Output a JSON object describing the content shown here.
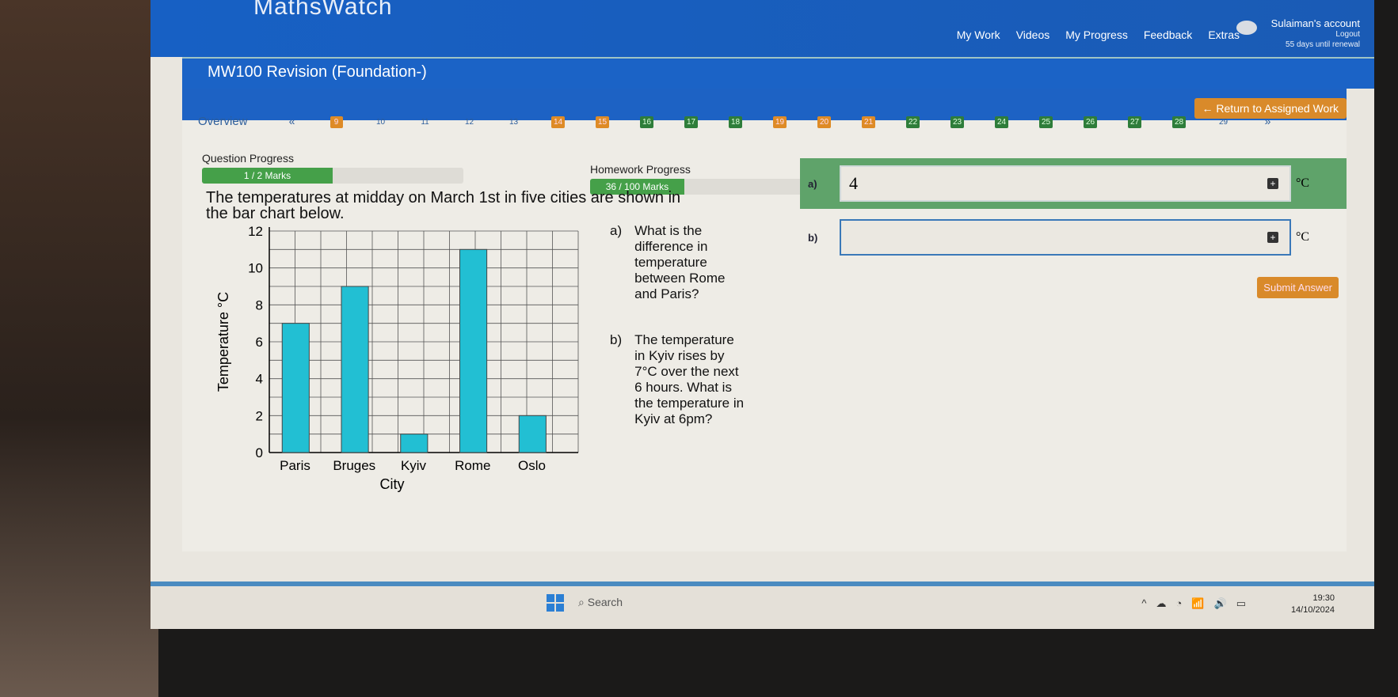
{
  "app": {
    "logo": "MathsWatch",
    "nav": [
      "My Work",
      "Videos",
      "My Progress",
      "Feedback",
      "Extras"
    ],
    "account": "Sulaiman's account",
    "logout": "Logout",
    "renewal": "55 days until renewal"
  },
  "course_title": "MW100 Revision (Foundation-)",
  "return_button": "← Return to Assigned Work",
  "overview": "Overview",
  "prev": "«",
  "next": "»",
  "questions": [
    {
      "n": "9",
      "s": "orange"
    },
    {
      "n": "10",
      "s": "none"
    },
    {
      "n": "11",
      "s": "none"
    },
    {
      "n": "12",
      "s": "none"
    },
    {
      "n": "13",
      "s": "none"
    },
    {
      "n": "14",
      "s": "orange"
    },
    {
      "n": "15",
      "s": "orange"
    },
    {
      "n": "16",
      "s": "green"
    },
    {
      "n": "17",
      "s": "green"
    },
    {
      "n": "18",
      "s": "green"
    },
    {
      "n": "19",
      "s": "orange"
    },
    {
      "n": "20",
      "s": "orange"
    },
    {
      "n": "21",
      "s": "orange"
    },
    {
      "n": "22",
      "s": "green"
    },
    {
      "n": "23",
      "s": "green"
    },
    {
      "n": "24",
      "s": "green"
    },
    {
      "n": "25",
      "s": "green"
    },
    {
      "n": "26",
      "s": "green"
    },
    {
      "n": "27",
      "s": "green"
    },
    {
      "n": "28",
      "s": "green"
    },
    {
      "n": "29",
      "s": "none"
    }
  ],
  "progress": {
    "question_label": "Question Progress",
    "question_value": "1 / 2 Marks",
    "question_fraction": 0.5,
    "homework_label": "Homework Progress",
    "homework_value": "36 / 100 Marks",
    "homework_fraction": 0.36
  },
  "question_text": "The temperatures at midday on March 1st in five cities are shown in the bar chart below.",
  "parts": [
    {
      "label": "a)",
      "text": "What is the difference in temperature between Rome and Paris?"
    },
    {
      "label": "b)",
      "text": "The temperature in Kyiv rises by 7°C over the next 6 hours. What is the temperature in Kyiv at 6pm?"
    }
  ],
  "answers": [
    {
      "label": "a)",
      "value": "4",
      "unit": "°C",
      "status": "correct"
    },
    {
      "label": "b)",
      "value": "",
      "unit": "°C",
      "status": "active"
    }
  ],
  "submit": "Submit Answer",
  "chart_data": {
    "type": "bar",
    "categories": [
      "Paris",
      "Bruges",
      "Kyiv",
      "Rome",
      "Oslo"
    ],
    "values": [
      7,
      9,
      1,
      11,
      2
    ],
    "xlabel": "City",
    "ylabel": "Temperature °C",
    "ylim": [
      0,
      12
    ],
    "yticks": [
      0,
      2,
      4,
      6,
      8,
      10,
      12
    ],
    "grid": true,
    "bar_color": "#22bfd3"
  },
  "taskbar": {
    "search": "Search",
    "time": "19:30",
    "date": "14/10/2024"
  },
  "colors": {
    "header": "#1760c4",
    "orange": "#d98a2a",
    "green": "#2e7d3a"
  }
}
